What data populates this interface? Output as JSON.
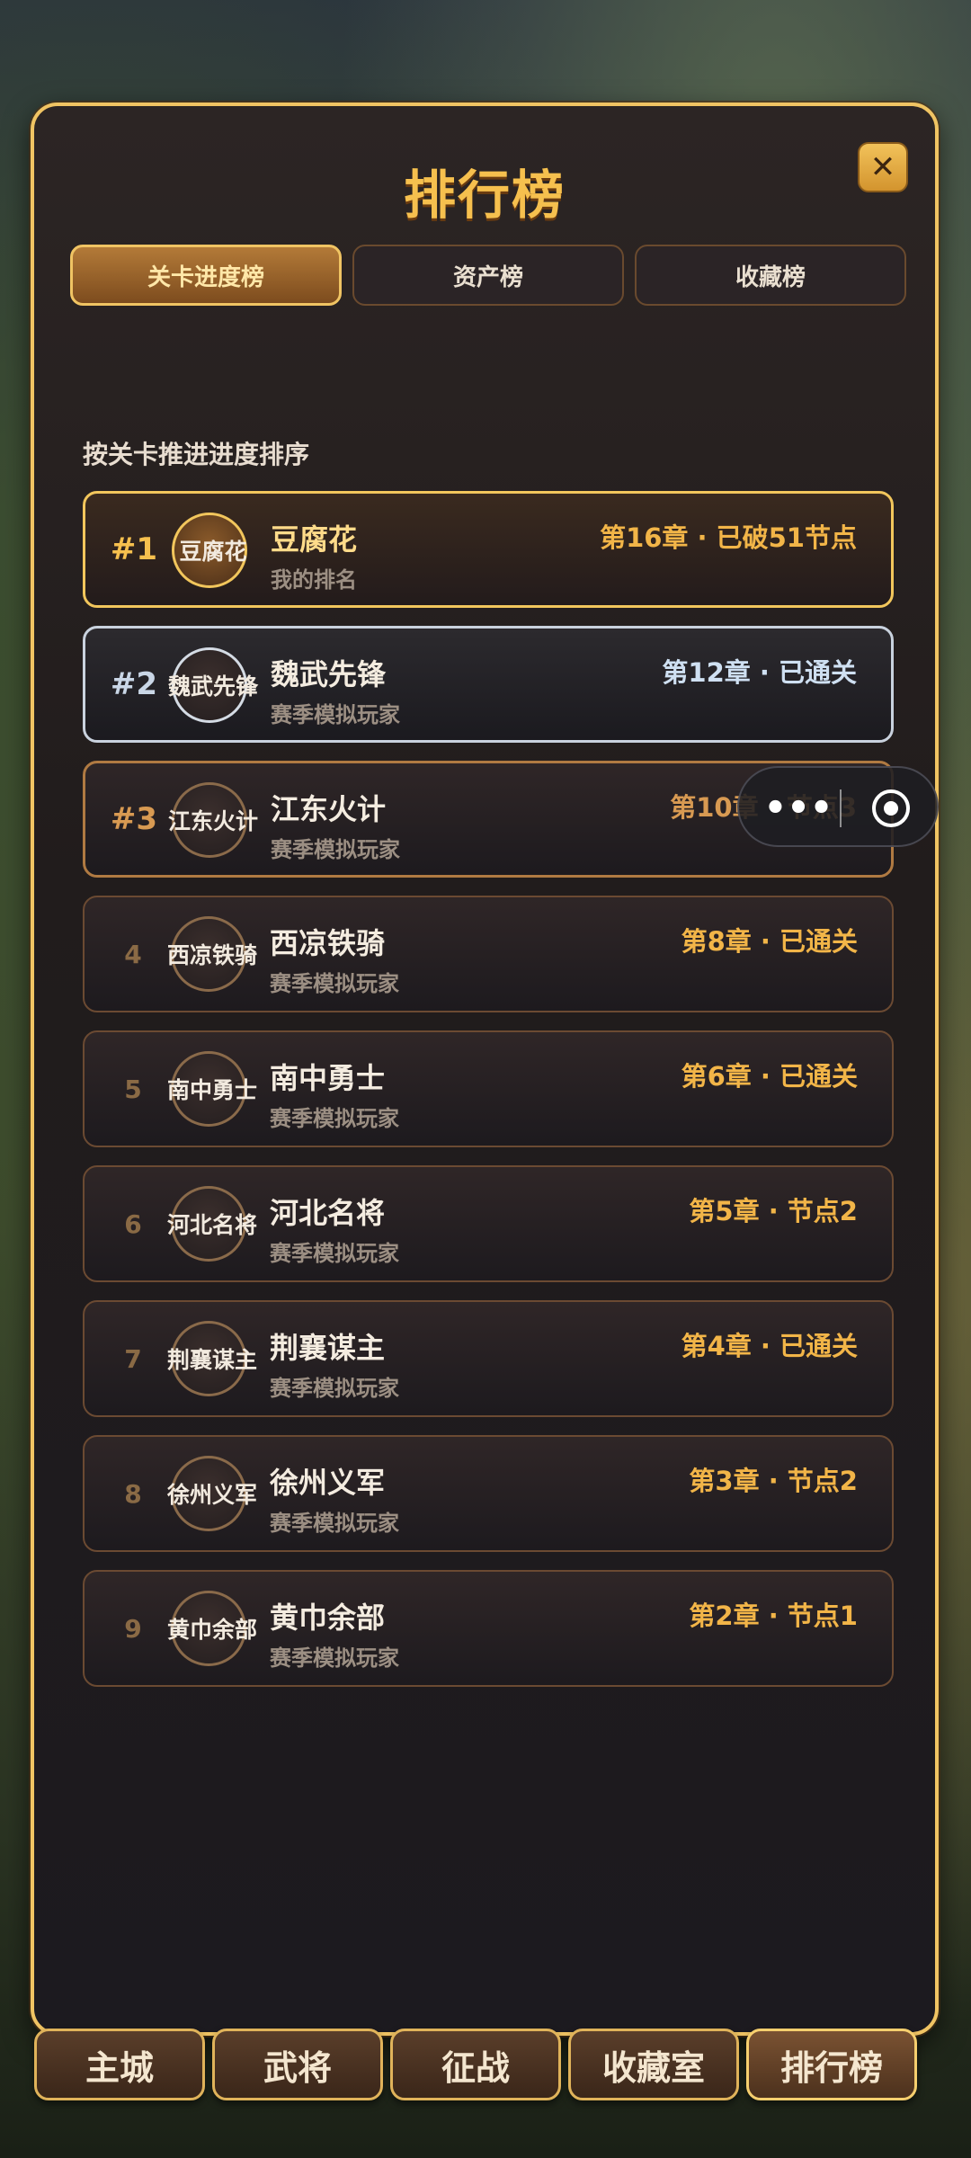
{
  "header": {
    "title": "排行榜",
    "close_label": "✕"
  },
  "tabs": [
    {
      "label": "关卡进度榜",
      "active": true
    },
    {
      "label": "资产榜",
      "active": false
    },
    {
      "label": "收藏榜",
      "active": false
    }
  ],
  "subtitle": "按关卡推进进度排序",
  "rankings": [
    {
      "rank": "#1",
      "avatar": "豆腐花",
      "name": "豆腐花",
      "desc": "我的排名",
      "progress": "第16章 · 已破51节点"
    },
    {
      "rank": "#2",
      "avatar": "魏武先锋",
      "name": "魏武先锋",
      "desc": "赛季模拟玩家",
      "progress": "第12章 · 已通关"
    },
    {
      "rank": "#3",
      "avatar": "江东火计",
      "name": "江东火计",
      "desc": "赛季模拟玩家",
      "progress": "第10章 · 节点3"
    },
    {
      "rank": "4",
      "avatar": "西凉铁骑",
      "name": "西凉铁骑",
      "desc": "赛季模拟玩家",
      "progress": "第8章 · 已通关"
    },
    {
      "rank": "5",
      "avatar": "南中勇士",
      "name": "南中勇士",
      "desc": "赛季模拟玩家",
      "progress": "第6章 · 已通关"
    },
    {
      "rank": "6",
      "avatar": "河北名将",
      "name": "河北名将",
      "desc": "赛季模拟玩家",
      "progress": "第5章 · 节点2"
    },
    {
      "rank": "7",
      "avatar": "荆襄谋主",
      "name": "荆襄谋主",
      "desc": "赛季模拟玩家",
      "progress": "第4章 · 已通关"
    },
    {
      "rank": "8",
      "avatar": "徐州义军",
      "name": "徐州义军",
      "desc": "赛季模拟玩家",
      "progress": "第3章 · 节点2"
    },
    {
      "rank": "9",
      "avatar": "黄巾余部",
      "name": "黄巾余部",
      "desc": "赛季模拟玩家",
      "progress": "第2章 · 节点1"
    }
  ],
  "capsule": {
    "more_label": "•••",
    "more_icon": "more-dots-icon",
    "close_icon": "target-icon"
  },
  "bottom_nav": [
    {
      "label": "主城",
      "active": false
    },
    {
      "label": "武将",
      "active": false
    },
    {
      "label": "征战",
      "active": false
    },
    {
      "label": "收藏室",
      "active": false
    },
    {
      "label": "排行榜",
      "active": true
    }
  ]
}
